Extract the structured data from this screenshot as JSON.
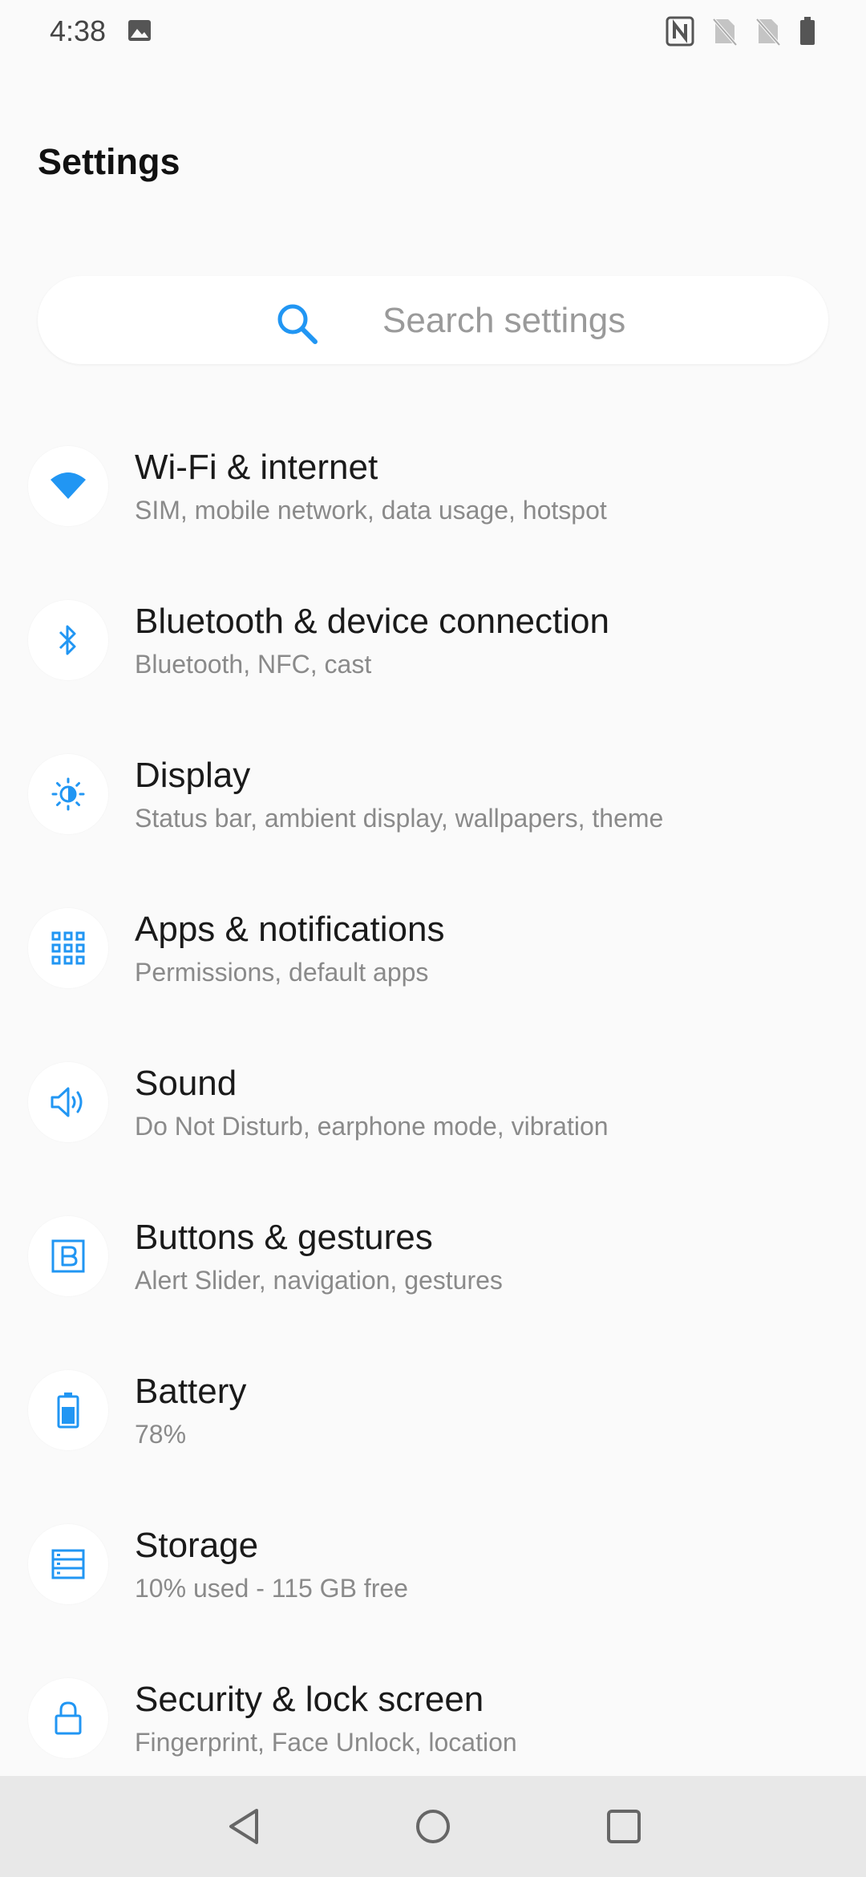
{
  "status_bar": {
    "time": "4:38",
    "left_icon": "image-icon",
    "right_icons": [
      "nfc-icon",
      "no-sim-icon",
      "no-sim-icon",
      "battery-icon"
    ]
  },
  "page": {
    "title": "Settings"
  },
  "search": {
    "placeholder": "Search settings",
    "icon": "search-icon"
  },
  "settings": [
    {
      "title": "Wi-Fi & internet",
      "subtitle": "SIM, mobile network, data usage, hotspot",
      "icon": "wifi-icon"
    },
    {
      "title": "Bluetooth & device connection",
      "subtitle": "Bluetooth, NFC, cast",
      "icon": "bluetooth-icon"
    },
    {
      "title": "Display",
      "subtitle": "Status bar, ambient display, wallpapers, theme",
      "icon": "brightness-icon"
    },
    {
      "title": "Apps & notifications",
      "subtitle": "Permissions, default apps",
      "icon": "apps-grid-icon"
    },
    {
      "title": "Sound",
      "subtitle": "Do Not Disturb, earphone mode, vibration",
      "icon": "speaker-icon"
    },
    {
      "title": "Buttons & gestures",
      "subtitle": "Alert Slider, navigation, gestures",
      "icon": "button-b-icon"
    },
    {
      "title": "Battery",
      "subtitle": "78%",
      "icon": "battery-icon"
    },
    {
      "title": "Storage",
      "subtitle": "10% used - 115 GB free",
      "icon": "storage-icon"
    },
    {
      "title": "Security & lock screen",
      "subtitle": "Fingerprint, Face Unlock, location",
      "icon": "lock-icon"
    }
  ],
  "nav_bar": {
    "buttons": [
      "back-icon",
      "home-icon",
      "recents-icon"
    ]
  },
  "colors": {
    "accent": "#2196f3",
    "background": "#fafafa",
    "nav_background": "#e8e8e8"
  }
}
